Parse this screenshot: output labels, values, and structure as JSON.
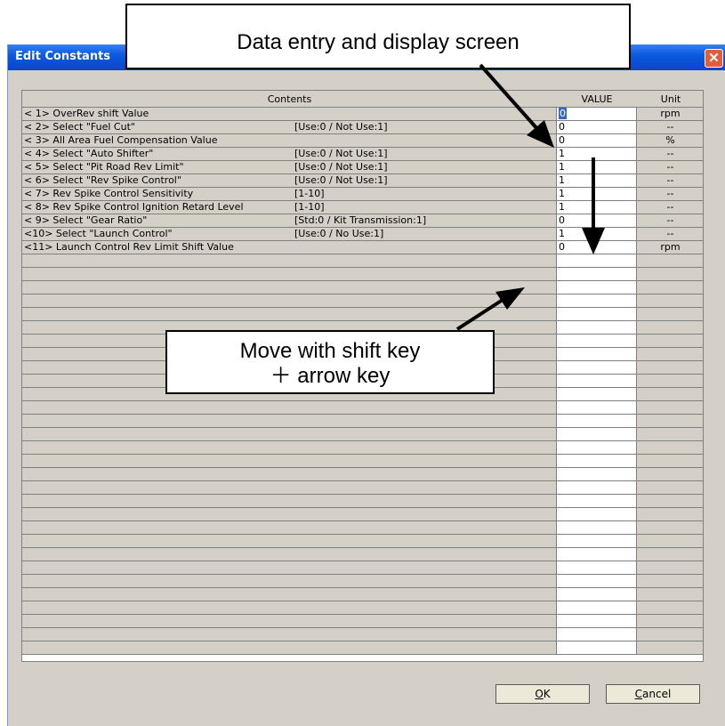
{
  "window": {
    "title": "Edit Constants",
    "close_glyph": "✕"
  },
  "table": {
    "headers": {
      "contents": "Contents",
      "value": "VALUE",
      "unit": "Unit"
    },
    "rows": [
      {
        "label": "< 1> OverRev shift Value",
        "option": "",
        "value": "0",
        "unit": "rpm",
        "selected": true
      },
      {
        "label": "< 2> Select \"Fuel Cut\"",
        "option": "[Use:0 / Not Use:1]",
        "value": "0",
        "unit": "--"
      },
      {
        "label": "< 3> All Area Fuel Compensation Value",
        "option": "",
        "value": "0",
        "unit": "%"
      },
      {
        "label": "< 4> Select \"Auto Shifter\"",
        "option": "[Use:0 / Not Use:1]",
        "value": "1",
        "unit": "--"
      },
      {
        "label": "< 5> Select \"Pit Road Rev Limit\"",
        "option": "[Use:0 / Not Use:1]",
        "value": "1",
        "unit": "--"
      },
      {
        "label": "< 6> Select \"Rev Spike Control\"",
        "option": "[Use:0 / Not Use:1]",
        "value": "1",
        "unit": "--"
      },
      {
        "label": "< 7> Rev Spike Control Sensitivity",
        "option": "[1-10]",
        "value": "1",
        "unit": "--"
      },
      {
        "label": "< 8> Rev Spike Control Ignition Retard Level",
        "option": "[1-10]",
        "value": "1",
        "unit": "--"
      },
      {
        "label": "< 9> Select \"Gear Ratio\"",
        "option": "[Std:0 / Kit Transmission:1]",
        "value": "0",
        "unit": "--"
      },
      {
        "label": "<10> Select \"Launch Control\"",
        "option": "[Use:0 / No Use:1]",
        "value": "1",
        "unit": "--"
      },
      {
        "label": "<11> Launch Control Rev Limit Shift Value",
        "option": "",
        "value": "0",
        "unit": "rpm"
      }
    ]
  },
  "buttons": {
    "ok": "OK",
    "ok_mnemonic": "O",
    "cancel": "Cancel",
    "cancel_mnemonic": "C"
  },
  "annotations": {
    "top": "Data entry and display screen",
    "middle_line1": "Move with shift key",
    "middle_line2": "＋ arrow key"
  },
  "colors": {
    "titlebar": "#0a5ae0",
    "face": "#d4d0c8",
    "selection": "#316ac5",
    "close": "#e35d3a"
  }
}
